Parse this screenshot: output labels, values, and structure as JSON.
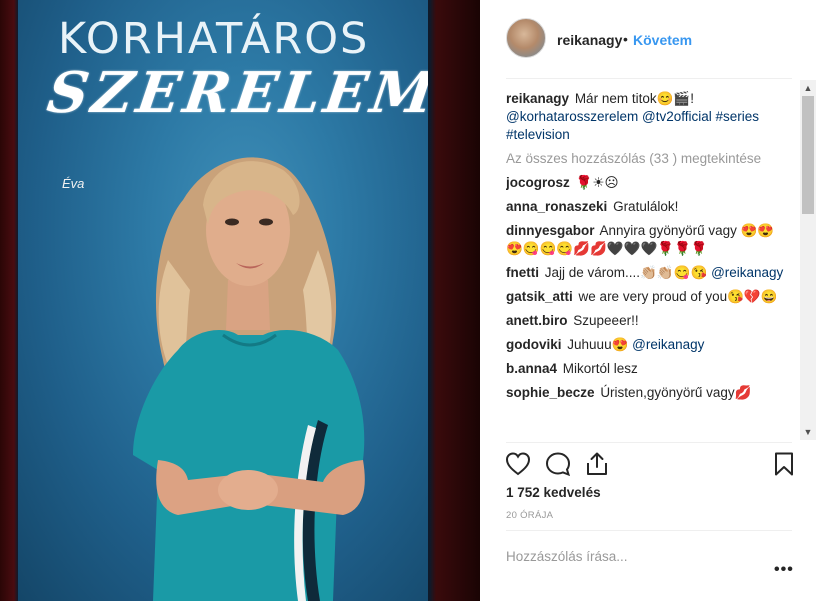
{
  "poster": {
    "title_line1": "KORHATÁROS",
    "title_line2": "SZERELEM",
    "character_name": "Éva"
  },
  "header": {
    "username": "reikanagy",
    "separator": "•",
    "follow_label": "Követem"
  },
  "caption": {
    "username": "reikanagy",
    "text": "Már nem titok😊🎬!",
    "tags": "@korhatarosszerelem @tv2official #series #television"
  },
  "view_all_comments": "Az összes hozzászólás (33 ) megtekintése",
  "comments": [
    {
      "user": "jocogrosz",
      "text": "🌹☀☹"
    },
    {
      "user": "anna_ronaszeki",
      "text": "Gratulálok!"
    },
    {
      "user": "dinnyesgabor",
      "text": "Annyira gyönyörű vagy 😍😍😍😋😋😋💋💋🖤🖤🖤🌹🌹🌹"
    },
    {
      "user": "fnetti",
      "text": "Jajj de várom....👏🏼👏🏼😋😘",
      "mention": "@reikanagy"
    },
    {
      "user": "gatsik_atti",
      "text": "we are very proud of you😘💔😄"
    },
    {
      "user": "anett.biro",
      "text": "Szupeeer!!"
    },
    {
      "user": "godoviki",
      "text": "Juhuuu😍",
      "mention": "@reikanagy"
    },
    {
      "user": "b.anna4",
      "text": "Mikortól lesz"
    },
    {
      "user": "sophie_becze",
      "text": "Úristen,gyönyörű vagy💋"
    }
  ],
  "actions": {
    "like_icon": "heart-outline-icon",
    "comment_icon": "speech-bubble-icon",
    "share_icon": "share-arrow-icon",
    "save_icon": "bookmark-icon"
  },
  "likes_text": "1 752 kedvelés",
  "time_text": "20 ÓRÁJA",
  "add_comment_placeholder": "Hozzászólás írása...",
  "more_label": "•••",
  "scrollbar": {
    "up_label": "▲",
    "down_label": "▼"
  },
  "colors": {
    "link": "#003569",
    "follow": "#3897f0",
    "muted": "#999999",
    "poster_bg": "#2d7aa6",
    "dress": "#1a9aa6"
  }
}
